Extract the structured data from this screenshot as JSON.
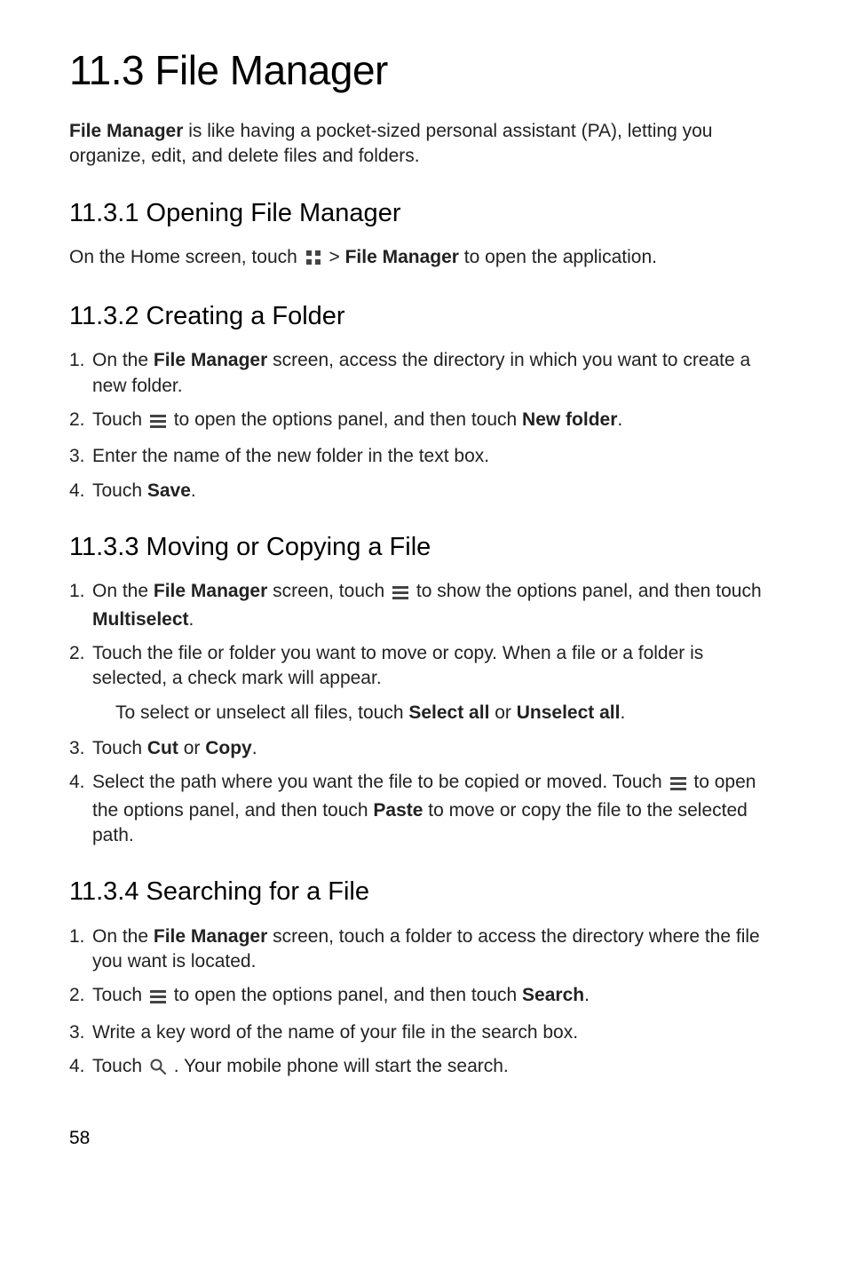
{
  "h1": "11.3  File Manager",
  "intro": {
    "pre": "File Manager",
    "post": " is like having a pocket-sized personal assistant (PA), letting you organize, edit, and delete files and folders."
  },
  "s1": {
    "title": "11.3.1  Opening File Manager",
    "p_pre": "On the Home screen, touch ",
    "p_mid": " > ",
    "p_bold": "File Manager",
    "p_post": " to open the application."
  },
  "s2": {
    "title": "11.3.2  Creating a Folder",
    "li1_pre": "On the ",
    "li1_bold": "File Manager",
    "li1_post": " screen, access the directory in which you want to create a new folder.",
    "li2_pre": "Touch ",
    "li2_mid": " to open the options panel, and then touch ",
    "li2_bold": "New folder",
    "li2_post": ".",
    "li3": "Enter the name of the new folder in the text box.",
    "li4_pre": "Touch ",
    "li4_bold": "Save",
    "li4_post": "."
  },
  "s3": {
    "title": "11.3.3  Moving or Copying a File",
    "li1_pre": "On the ",
    "li1_bold1": "File Manager",
    "li1_mid": " screen, touch ",
    "li1_post": " to show the options panel, and then touch ",
    "li1_bold2": "Multiselect",
    "li1_end": ".",
    "li2": "Touch the file or folder you want to move or copy. When a file or a folder is selected, a check mark will appear.",
    "note_pre": "To select or unselect all files, touch ",
    "note_b1": "Select all",
    "note_mid": " or ",
    "note_b2": "Unselect all",
    "note_end": ".",
    "li3_pre": "Touch ",
    "li3_b1": "Cut",
    "li3_mid": " or ",
    "li3_b2": "Copy",
    "li3_end": ".",
    "li4_pre": "Select the path where you want the file to be copied or moved. Touch ",
    "li4_mid": " to open the options panel, and then touch ",
    "li4_bold": "Paste",
    "li4_post": " to move or copy the file to the selected path."
  },
  "s4": {
    "title": "11.3.4  Searching for a File",
    "li1_pre": "On the ",
    "li1_bold": "File Manager",
    "li1_post": " screen, touch a folder to access the directory where the file you want is located.",
    "li2_pre": "Touch ",
    "li2_mid": " to open the options panel, and then touch ",
    "li2_bold": "Search",
    "li2_post": ".",
    "li3": "Write a key word of the name of your file in the search box.",
    "li4_pre": "Touch ",
    "li4_post": " . Your mobile phone will start the search."
  },
  "pagenum": "58"
}
